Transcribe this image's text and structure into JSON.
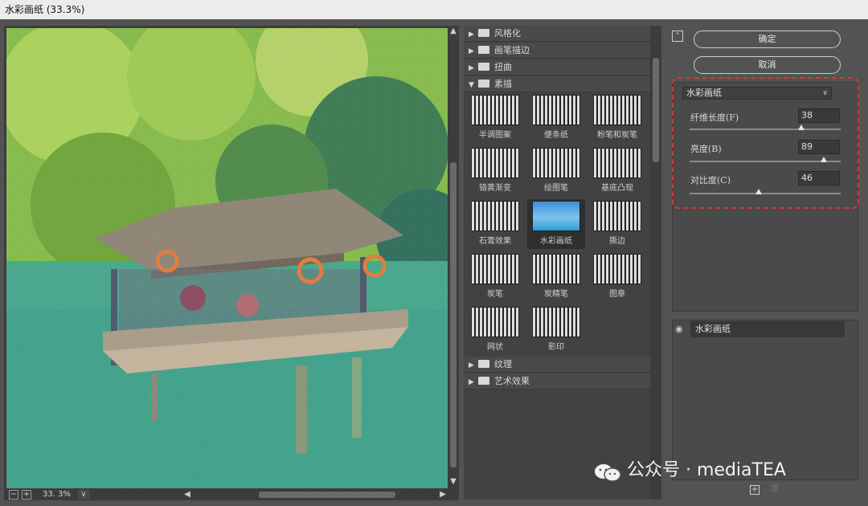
{
  "window": {
    "title": "水彩画纸 (33.3%)"
  },
  "preview": {
    "zoom": "33. 3%",
    "zoom_out": "−",
    "zoom_in": "+"
  },
  "gallery": {
    "categories_top": [
      {
        "label": "风格化",
        "expanded": false
      },
      {
        "label": "画笔描边",
        "expanded": false
      },
      {
        "label": "扭曲",
        "expanded": false
      },
      {
        "label": "素描",
        "expanded": true
      }
    ],
    "thumbnails": [
      {
        "label": "半调图案"
      },
      {
        "label": "便条纸"
      },
      {
        "label": "粉笔和炭笔"
      },
      {
        "label": "铬黄渐变"
      },
      {
        "label": "绘图笔"
      },
      {
        "label": "基底凸现"
      },
      {
        "label": "石膏效果"
      },
      {
        "label": "水彩画纸",
        "selected": true
      },
      {
        "label": "撕边"
      },
      {
        "label": "炭笔"
      },
      {
        "label": "炭精笔"
      },
      {
        "label": "图章"
      },
      {
        "label": "网状"
      },
      {
        "label": "影印"
      }
    ],
    "categories_bottom": [
      {
        "label": "纹理",
        "expanded": false
      },
      {
        "label": "艺术效果",
        "expanded": false
      }
    ]
  },
  "actions": {
    "ok": "确定",
    "cancel": "取消"
  },
  "settings": {
    "filter": "水彩画纸",
    "params": [
      {
        "label": "纤维长度(F)",
        "value": "38",
        "fraction": 0.74
      },
      {
        "label": "亮度(B)",
        "value": "89",
        "fraction": 0.89
      },
      {
        "label": "对比度(C)",
        "value": "46",
        "fraction": 0.46
      }
    ]
  },
  "layers": [
    {
      "label": "水彩画纸",
      "visible": true
    }
  ],
  "watermark": {
    "text": "公众号 · mediaTEA"
  },
  "colors": {
    "highlight_box": "#d23a3a",
    "panel": "#535353"
  }
}
